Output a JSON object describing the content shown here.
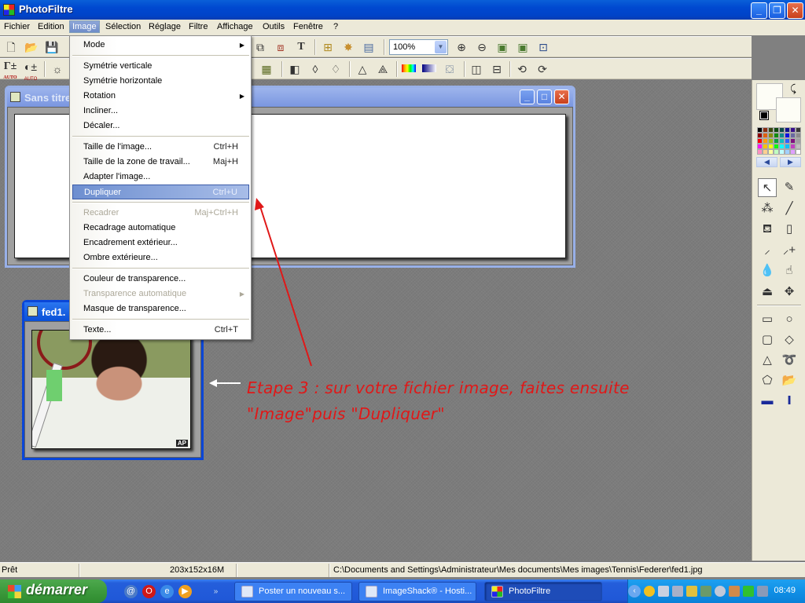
{
  "window": {
    "title": "PhotoFiltre",
    "controls": [
      "minimize",
      "restore",
      "close"
    ]
  },
  "menubar": {
    "items": [
      "Fichier",
      "Edition",
      "Image",
      "Sélection",
      "Réglage",
      "Filtre",
      "Affichage",
      "Outils",
      "Fenêtre",
      "?"
    ],
    "active": "Image"
  },
  "toolbar": {
    "zoom_value": "100%",
    "row1_icons": [
      "new-icon",
      "open-icon",
      "save-icon",
      "copy-picture-icon",
      "paste-picture-icon",
      "text-icon",
      "explorer-icon",
      "plugin-icon",
      "window-icon",
      "zoom-in-icon",
      "zoom-out-icon",
      "fit-image-icon",
      "actual-size-icon",
      "fullscreen-icon"
    ],
    "row2_icons": [
      "gamma-auto-icon",
      "contrast-auto-icon",
      "brightness-icon",
      "grid-icon",
      "blur-icon",
      "drop-icon",
      "drops-icon",
      "sharpen-icon",
      "sharpen-more-icon",
      "gradient-rainbow-icon",
      "gradient-blue-icon",
      "negative-icon",
      "flip-horizontal-icon",
      "flip-vertical-icon",
      "rotate-left-icon",
      "rotate-right-icon"
    ],
    "gamma_label": "AUTO",
    "contrast_label": "AUTO"
  },
  "image_menu": {
    "items": [
      {
        "label": "Mode",
        "shortcut": "",
        "submenu": true,
        "disabled": false
      },
      {
        "separator": true
      },
      {
        "label": "Symétrie verticale",
        "shortcut": "",
        "submenu": false,
        "disabled": false
      },
      {
        "label": "Symétrie horizontale",
        "shortcut": "",
        "submenu": false,
        "disabled": false
      },
      {
        "label": "Rotation",
        "shortcut": "",
        "submenu": true,
        "disabled": false
      },
      {
        "label": "Incliner...",
        "shortcut": "",
        "submenu": false,
        "disabled": false
      },
      {
        "label": "Décaler...",
        "shortcut": "",
        "submenu": false,
        "disabled": false
      },
      {
        "separator": true
      },
      {
        "label": "Taille de l'image...",
        "shortcut": "Ctrl+H",
        "submenu": false,
        "disabled": false
      },
      {
        "label": "Taille de la zone de travail...",
        "shortcut": "Maj+H",
        "submenu": false,
        "disabled": false
      },
      {
        "label": "Adapter l'image...",
        "shortcut": "",
        "submenu": false,
        "disabled": false
      },
      {
        "label": "Dupliquer",
        "shortcut": "Ctrl+U",
        "submenu": false,
        "disabled": false,
        "highlighted": true
      },
      {
        "separator": true
      },
      {
        "label": "Recadrer",
        "shortcut": "Maj+Ctrl+H",
        "submenu": false,
        "disabled": true
      },
      {
        "label": "Recadrage automatique",
        "shortcut": "",
        "submenu": false,
        "disabled": false
      },
      {
        "label": "Encadrement extérieur...",
        "shortcut": "",
        "submenu": false,
        "disabled": false
      },
      {
        "label": "Ombre extérieure...",
        "shortcut": "",
        "submenu": false,
        "disabled": false
      },
      {
        "separator": true
      },
      {
        "label": "Couleur de transparence...",
        "shortcut": "",
        "submenu": false,
        "disabled": false
      },
      {
        "label": "Transparence automatique",
        "shortcut": "",
        "submenu": true,
        "disabled": true
      },
      {
        "label": "Masque de transparence...",
        "shortcut": "",
        "submenu": false,
        "disabled": false
      },
      {
        "separator": true
      },
      {
        "label": "Texte...",
        "shortcut": "Ctrl+T",
        "submenu": false,
        "disabled": false
      }
    ]
  },
  "documents": [
    {
      "title": "Sans titre",
      "state": "inactive"
    },
    {
      "title": "fed1.",
      "state": "active",
      "watermark": "AP"
    }
  ],
  "annotation": {
    "line1": "Etape 3 : sur votre fichier image, faites ensuite",
    "line2": "\"Image\"puis \"Dupliquer\"",
    "color": "#e01818"
  },
  "right_panel": {
    "palette": [
      "#000000",
      "#8b2e10",
      "#3a4a10",
      "#104a10",
      "#104a4a",
      "#10108b",
      "#3a108b",
      "#3a3a3a",
      "#8b0000",
      "#e06010",
      "#8b8b10",
      "#108b10",
      "#108b8b",
      "#1010e0",
      "#6a6aa0",
      "#8b8b8b",
      "#ff0000",
      "#ff9a10",
      "#a0c010",
      "#10a040",
      "#10c0c0",
      "#3060ff",
      "#801080",
      "#a0a0a0",
      "#ff10ff",
      "#ffc000",
      "#ffff10",
      "#10ff10",
      "#10ffff",
      "#10c0ff",
      "#c040c0",
      "#c0c0c0",
      "#ff90c0",
      "#ffd090",
      "#ffffa0",
      "#c0ffc0",
      "#c0ffff",
      "#a0d0ff",
      "#e0a0ff",
      "#ffffff"
    ],
    "tools": [
      "selection-arrow-icon",
      "eyedropper-icon",
      "magic-wand-icon",
      "line-icon",
      "paint-bucket-icon",
      "spray-icon",
      "brush-icon",
      "advanced-brush-icon",
      "blur-drop-icon",
      "smudge-finger-icon",
      "stamp-icon",
      "move-icon"
    ],
    "shapes": [
      "rectangle-icon",
      "ellipse-icon",
      "rounded-rect-icon",
      "diamond-icon",
      "triangle-icon",
      "lasso-icon",
      "polygon-icon",
      "open-selection-icon",
      "horizontal-select-icon",
      "vertical-select-icon"
    ]
  },
  "statusbar": {
    "status": "Prêt",
    "dimensions": "203x152x16M",
    "path": "C:\\Documents and Settings\\Administrateur\\Mes documents\\Mes images\\Tennis\\Federer\\fed1.jpg"
  },
  "taskbar": {
    "start_label": "démarrer",
    "quicklaunch": [
      "outlook-icon",
      "opera-icon",
      "ie-icon",
      "media-player-icon"
    ],
    "tasks": [
      {
        "label": "Poster un nouveau s...",
        "active": false
      },
      {
        "label": "ImageShack® - Hosti...",
        "active": false
      },
      {
        "label": "PhotoFiltre",
        "active": true
      }
    ],
    "clock": "08:49"
  }
}
